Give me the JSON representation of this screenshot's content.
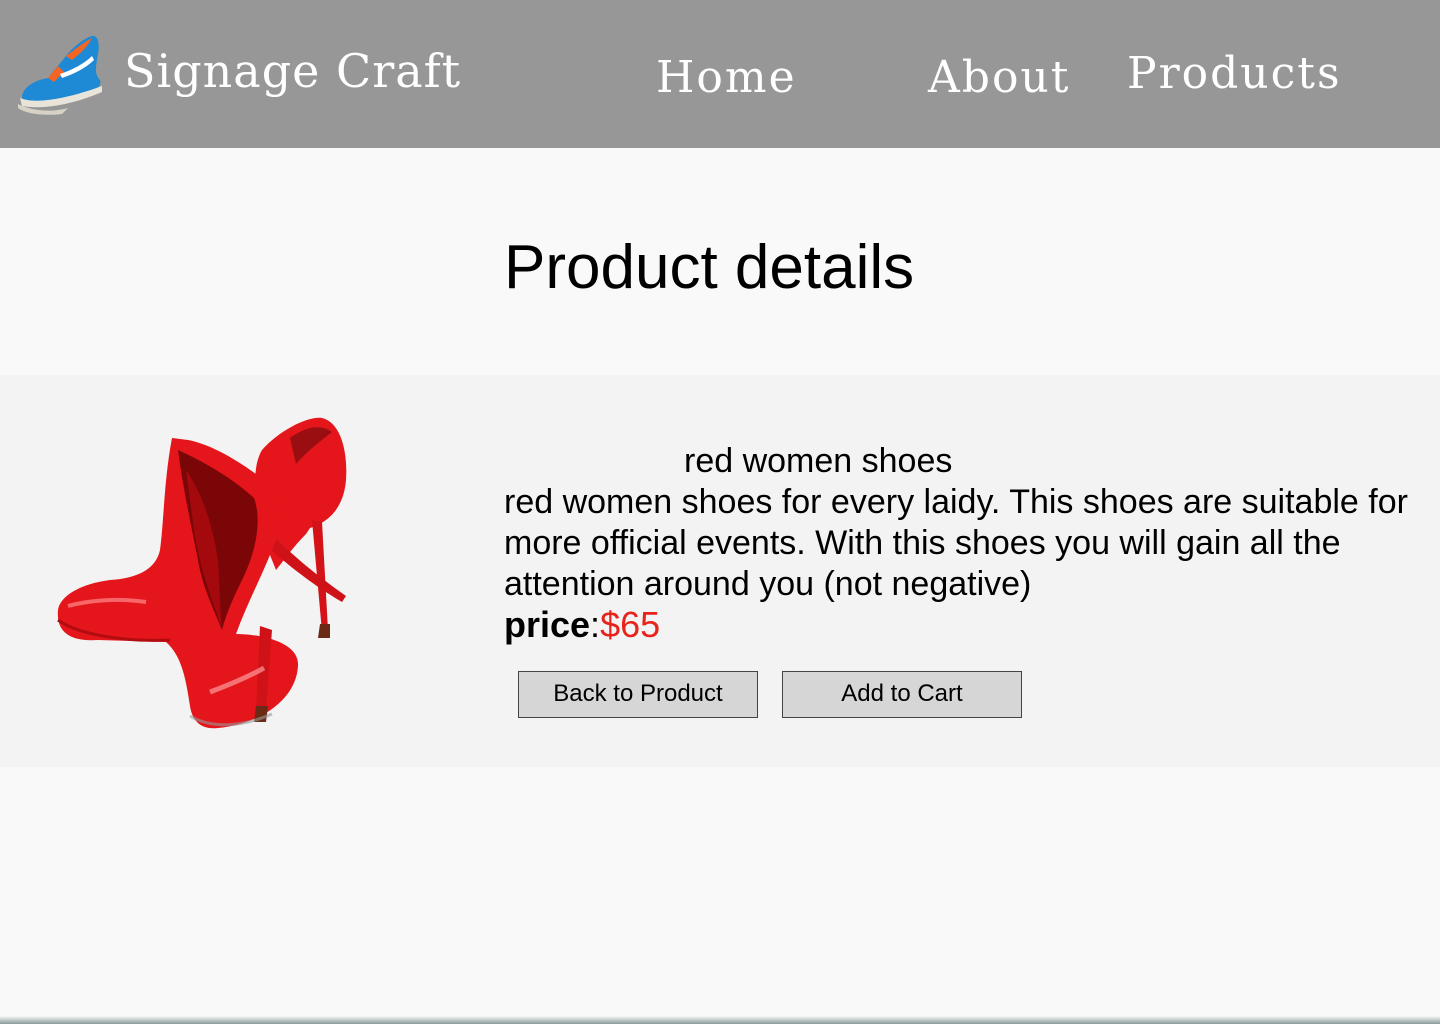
{
  "header": {
    "brand": "Signage Craft",
    "nav": {
      "home": "Home",
      "about": "About",
      "products": "Products"
    },
    "logo_icon": "sneaker-logo-icon"
  },
  "main": {
    "title": "Product details",
    "product": {
      "name": "red women shoes",
      "description": "red women shoes for every laidy. This shoes are suitable for more official events. With this shoes you will gain all the attention around you (not negative)",
      "price_label": "price",
      "price_separator": ":",
      "price_value": "$65",
      "image_icon": "red-high-heels-image"
    },
    "buttons": {
      "back": "Back to Product",
      "add_to_cart": "Add to Cart"
    }
  },
  "colors": {
    "header_bg": "#979797",
    "band_bg": "#f3f3f3",
    "price": "#e8231c",
    "button_bg": "#d6d6d6"
  }
}
